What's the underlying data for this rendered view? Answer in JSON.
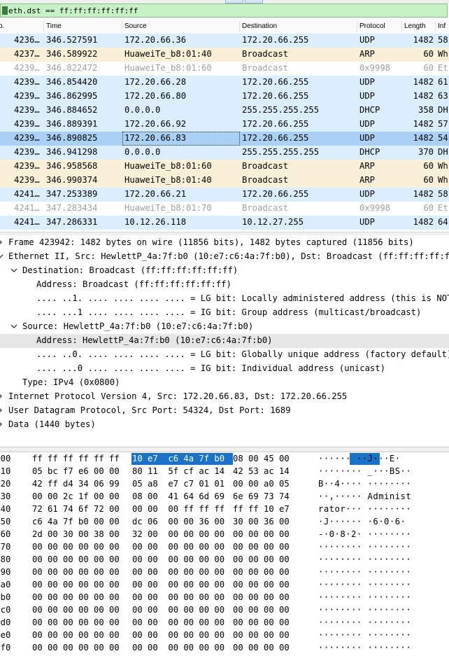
{
  "filter": {
    "value": "eth.dst == ff:ff:ff:ff:ff:ff",
    "bookmark_icon": "bookmark-icon"
  },
  "columns": {
    "no": "o.",
    "time": "Time",
    "source": "Source",
    "destination": "Destination",
    "protocol": "Protocol",
    "length": "Length",
    "info": "Inf"
  },
  "colors": {
    "udp_row": "#daeeff",
    "arp_row": "#faf0d7",
    "sel_row": "#a9d1f5",
    "muted_text": "#a0a0a0",
    "filter_bg": "#c6f2c6",
    "hex_highlight": "#1a73c9"
  },
  "packets": [
    {
      "no": "4236…",
      "time": "346.527591",
      "src": "172.20.66.36",
      "dst": "172.20.66.255",
      "proto": "UDP",
      "len": "1482",
      "info": "58",
      "kind": "udp"
    },
    {
      "no": "4237…",
      "time": "346.589922",
      "src": "HuaweiTe_b8:01:40",
      "dst": "Broadcast",
      "proto": "ARP",
      "len": "60",
      "info": "Wh",
      "kind": "arp"
    },
    {
      "no": "4239…",
      "time": "346.822472",
      "src": "HuaweiTe_b8:01:60",
      "dst": "Broadcast",
      "proto": "0x9998",
      "len": "60",
      "info": "Et",
      "kind": "muted"
    },
    {
      "no": "4239…",
      "time": "346.854420",
      "src": "172.20.66.28",
      "dst": "172.20.66.255",
      "proto": "UDP",
      "len": "1482",
      "info": "61",
      "kind": "udp"
    },
    {
      "no": "4239…",
      "time": "346.862995",
      "src": "172.20.66.80",
      "dst": "172.20.66.255",
      "proto": "UDP",
      "len": "1482",
      "info": "63",
      "kind": "udp"
    },
    {
      "no": "4239…",
      "time": "346.884652",
      "src": "0.0.0.0",
      "dst": "255.255.255.255",
      "proto": "DHCP",
      "len": "358",
      "info": "DH",
      "kind": "udp"
    },
    {
      "no": "4239…",
      "time": "346.889391",
      "src": "172.20.66.92",
      "dst": "172.20.66.255",
      "proto": "UDP",
      "len": "1482",
      "info": "57",
      "kind": "udp"
    },
    {
      "no": "4239…",
      "time": "346.890825",
      "src": "172.20.66.83",
      "dst": "172.20.66.255",
      "proto": "UDP",
      "len": "1482",
      "info": "54",
      "kind": "sel"
    },
    {
      "no": "4239…",
      "time": "346.941298",
      "src": "0.0.0.0",
      "dst": "255.255.255.255",
      "proto": "DHCP",
      "len": "370",
      "info": "DH",
      "kind": "udp"
    },
    {
      "no": "4239…",
      "time": "346.958568",
      "src": "HuaweiTe_b8:01:60",
      "dst": "Broadcast",
      "proto": "ARP",
      "len": "60",
      "info": "Wh",
      "kind": "arp"
    },
    {
      "no": "4239…",
      "time": "346.990374",
      "src": "HuaweiTe_b8:01:40",
      "dst": "Broadcast",
      "proto": "ARP",
      "len": "60",
      "info": "Wh",
      "kind": "arp"
    },
    {
      "no": "4241…",
      "time": "347.253389",
      "src": "172.20.66.21",
      "dst": "172.20.66.255",
      "proto": "UDP",
      "len": "1482",
      "info": "58",
      "kind": "udp"
    },
    {
      "no": "4241…",
      "time": "347.283434",
      "src": "HuaweiTe_b8:01:70",
      "dst": "Broadcast",
      "proto": "0x9998",
      "len": "60",
      "info": "Et",
      "kind": "muted"
    },
    {
      "no": "4241…",
      "time": "347.286331",
      "src": "10.12.26.118",
      "dst": "10.12.27.255",
      "proto": "UDP",
      "len": "1482",
      "info": "64",
      "kind": "udp"
    }
  ],
  "details": [
    {
      "text": "Frame 423942: 1482 bytes on wire (11856 bits), 1482 bytes captured (11856 bits)",
      "level": 0,
      "toggle": "collapsed"
    },
    {
      "text": "Ethernet II, Src: HewlettP_4a:7f:b0 (10:e7:c6:4a:7f:b0), Dst: Broadcast (ff:ff:ff:ff:ff:ff)",
      "level": 0,
      "toggle": "expanded"
    },
    {
      "text": "Destination: Broadcast (ff:ff:ff:ff:ff:ff)",
      "level": 1,
      "toggle": "expanded"
    },
    {
      "text": "Address: Broadcast (ff:ff:ff:ff:ff:ff)",
      "level": 2,
      "toggle": "none"
    },
    {
      "text": ".... ..1. .... .... .... .... = LG bit: Locally administered address (this is NOT the factory default)",
      "level": 2,
      "toggle": "none"
    },
    {
      "text": ".... ...1 .... .... .... .... = IG bit: Group address (multicast/broadcast)",
      "level": 2,
      "toggle": "none"
    },
    {
      "text": "Source: HewlettP_4a:7f:b0 (10:e7:c6:4a:7f:b0)",
      "level": 1,
      "toggle": "expanded"
    },
    {
      "text": "Address: HewlettP_4a:7f:b0 (10:e7:c6:4a:7f:b0)",
      "level": 2,
      "toggle": "none",
      "selected": true
    },
    {
      "text": ".... ..0. .... .... .... .... = LG bit: Globally unique address (factory default)",
      "level": 2,
      "toggle": "none"
    },
    {
      "text": ".... ...0 .... .... .... .... = IG bit: Individual address (unicast)",
      "level": 2,
      "toggle": "none"
    },
    {
      "text": "Type: IPv4 (0x0800)",
      "level": 1,
      "toggle": "none"
    },
    {
      "text": "Internet Protocol Version 4, Src: 172.20.66.83, Dst: 172.20.66.255",
      "level": 0,
      "toggle": "collapsed"
    },
    {
      "text": "User Datagram Protocol, Src Port: 54324, Dst Port: 1689",
      "level": 0,
      "toggle": "collapsed"
    },
    {
      "text": "Data (1440 bytes)",
      "level": 0,
      "toggle": "collapsed"
    }
  ],
  "hex": [
    {
      "off": "0000",
      "b1": "ff ff ff ff ff ff",
      "b2": "10 e7  c6 4a 7f b0",
      "b3": "08 00 45 00",
      "asc": "······ ··J···E·"
    },
    {
      "off": "0010",
      "b1": "05 bc f7 e6 00 00",
      "b2": "80 11  5f cf ac 14",
      "b3": "42 53 ac 14",
      "asc": "········ _···BS··"
    },
    {
      "off": "0020",
      "b1": "42 ff d4 34 06 99",
      "b2": "05 a8  e7 c7 01 01",
      "b3": "00 00 a0 05",
      "asc": "B··4···· ········"
    },
    {
      "off": "0030",
      "b1": "00 00 2c 1f 00 00",
      "b2": "08 00  41 64 6d 69",
      "b3": "6e 69 73 74",
      "asc": "··,····· Administ"
    },
    {
      "off": "0040",
      "b1": "72 61 74 6f 72 00",
      "b2": "00 00  00 ff ff ff",
      "b3": "ff ff 10 e7",
      "asc": "rator··· ········"
    },
    {
      "off": "0050",
      "b1": "c6 4a 7f b0 00 00",
      "b2": "dc 06  00 00 36 00",
      "b3": "30 00 36 00",
      "asc": "·J······ ·6·0·6·"
    },
    {
      "off": "0060",
      "b1": "2d 00 30 00 38 00",
      "b2": "32 00  00 00 00 00",
      "b3": "00 00 00 00",
      "asc": "-·0·8·2· ········"
    },
    {
      "off": "0070",
      "b1": "00 00 00 00 00 00",
      "b2": "00 00  00 00 00 00",
      "b3": "00 00 00 00",
      "asc": "········ ········"
    },
    {
      "off": "0080",
      "b1": "00 00 00 00 00 00",
      "b2": "00 00  00 00 00 00",
      "b3": "00 00 00 00",
      "asc": "········ ········"
    },
    {
      "off": "0090",
      "b1": "00 00 00 00 00 00",
      "b2": "00 00  00 00 00 00",
      "b3": "00 00 00 00",
      "asc": "········ ········"
    },
    {
      "off": "00a0",
      "b1": "00 00 00 00 00 00",
      "b2": "00 00  00 00 00 00",
      "b3": "00 00 00 00",
      "asc": "········ ········"
    },
    {
      "off": "00b0",
      "b1": "00 00 00 00 00 00",
      "b2": "00 00  00 00 00 00",
      "b3": "00 00 00 00",
      "asc": "········ ········"
    },
    {
      "off": "00c0",
      "b1": "00 00 00 00 00 00",
      "b2": "00 00  00 00 00 00",
      "b3": "00 00 00 00",
      "asc": "········ ········"
    },
    {
      "off": "00d0",
      "b1": "00 00 00 00 00 00",
      "b2": "00 00  00 00 00 00",
      "b3": "00 00 00 00",
      "asc": "········ ········"
    },
    {
      "off": "00e0",
      "b1": "00 00 00 00 00 00",
      "b2": "00 00  00 00 00 00",
      "b3": "00 00 00 00",
      "asc": "········ ········"
    },
    {
      "off": "00f0",
      "b1": "00 00 00 00 00 00",
      "b2": "00 00  00 00 00 00",
      "b3": "00 00 00 00",
      "asc": "········ ········"
    }
  ]
}
